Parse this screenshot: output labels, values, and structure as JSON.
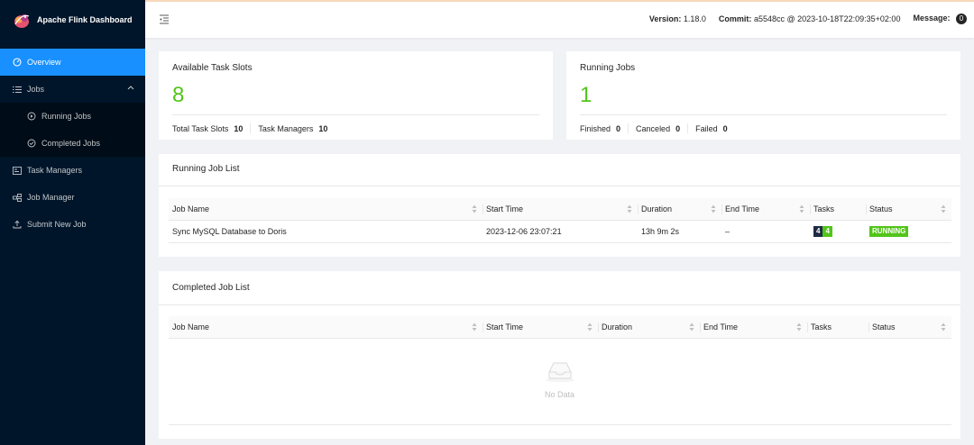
{
  "app": {
    "title": "Apache Flink Dashboard"
  },
  "sidebar": {
    "items": [
      {
        "label": "Overview",
        "icon": "dashboard-icon"
      },
      {
        "label": "Jobs",
        "icon": "list-icon"
      },
      {
        "label": "Running Jobs",
        "icon": "play-circle-icon"
      },
      {
        "label": "Completed Jobs",
        "icon": "check-circle-icon"
      },
      {
        "label": "Task Managers",
        "icon": "task-managers-icon"
      },
      {
        "label": "Job Manager",
        "icon": "cluster-icon"
      },
      {
        "label": "Submit New Job",
        "icon": "upload-icon"
      }
    ]
  },
  "header": {
    "version_label": "Version:",
    "version_value": "1.18.0",
    "commit_label": "Commit:",
    "commit_value": "a5548cc @ 2023-10-18T22:09:35+02:00",
    "message_label": "Message:",
    "message_count": "0"
  },
  "slots": {
    "title": "Available Task Slots",
    "value": "8",
    "total_label": "Total Task Slots",
    "total_value": "10",
    "tm_label": "Task Managers",
    "tm_value": "10"
  },
  "running": {
    "title": "Running Jobs",
    "value": "1",
    "finished_label": "Finished",
    "finished_value": "0",
    "canceled_label": "Canceled",
    "canceled_value": "0",
    "failed_label": "Failed",
    "failed_value": "0"
  },
  "running_list": {
    "title": "Running Job List",
    "columns": [
      "Job Name",
      "Start Time",
      "Duration",
      "End Time",
      "Tasks",
      "Status"
    ],
    "rows": [
      {
        "name": "Sync MySQL Database to Doris",
        "start": "2023-12-06 23:07:21",
        "duration": "13h 9m 2s",
        "end": "–",
        "tasks_total": "4",
        "tasks_running": "4",
        "status": "RUNNING"
      }
    ]
  },
  "completed_list": {
    "title": "Completed Job List",
    "columns": [
      "Job Name",
      "Start Time",
      "Duration",
      "End Time",
      "Tasks",
      "Status"
    ],
    "empty_text": "No Data"
  },
  "colors": {
    "sidebar_bg": "#001529",
    "active": "#1890ff",
    "success": "#52c41a"
  }
}
